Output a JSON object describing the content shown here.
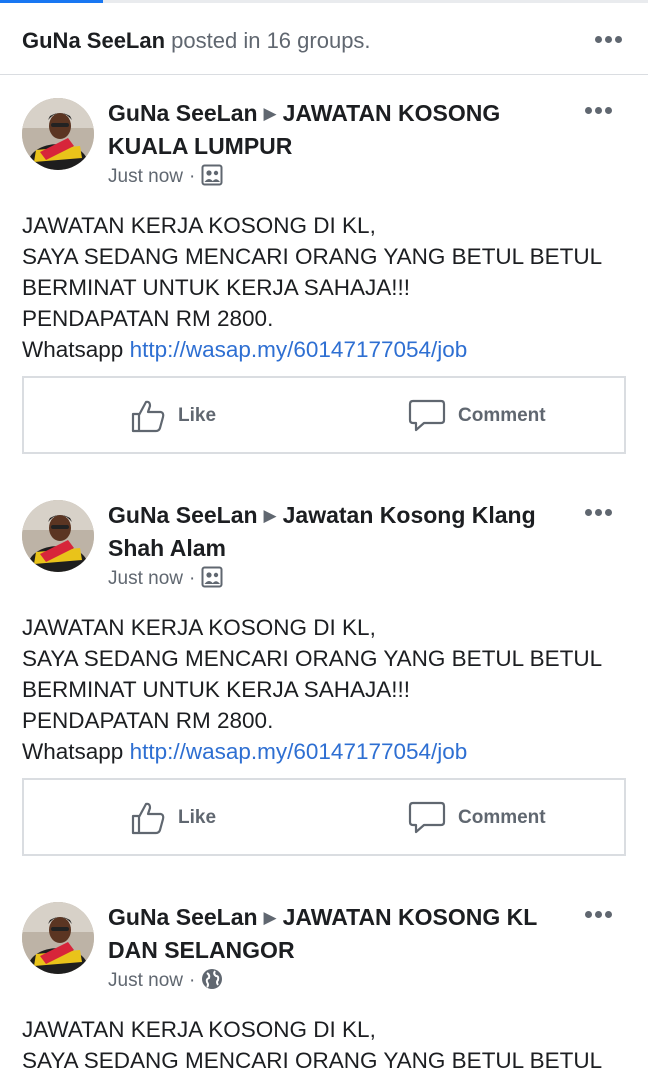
{
  "header": {
    "author": "GuNa SeeLan",
    "rest": "posted in 16 groups."
  },
  "posts": [
    {
      "author": "GuNa SeeLan",
      "group": "JAWATAN KOSONG KUALA LUMPUR",
      "time": "Just now",
      "audience_icon": "group-icon",
      "lines": [
        "JAWATAN KERJA KOSONG DI KL,",
        "SAYA SEDANG MENCARI ORANG YANG BETUL BETUL",
        "BERMINAT UNTUK KERJA SAHAJA!!!",
        "PENDAPATAN RM 2800."
      ],
      "link_prefix": "Whatsapp",
      "link": "http://wasap.my/60147177054/job",
      "like_label": "Like",
      "comment_label": "Comment"
    },
    {
      "author": "GuNa SeeLan",
      "group": "Jawatan Kosong Klang Shah Alam",
      "time": "Just now",
      "audience_icon": "group-icon",
      "lines": [
        "JAWATAN KERJA KOSONG DI KL,",
        "SAYA SEDANG MENCARI ORANG YANG BETUL BETUL",
        "BERMINAT UNTUK KERJA SAHAJA!!!",
        "PENDAPATAN RM 2800."
      ],
      "link_prefix": "Whatsapp",
      "link": "http://wasap.my/60147177054/job",
      "like_label": "Like",
      "comment_label": "Comment"
    },
    {
      "author": "GuNa SeeLan",
      "group": "JAWATAN KOSONG KL DAN SELANGOR",
      "time": "Just now",
      "audience_icon": "globe-icon",
      "lines": [
        "JAWATAN KERJA KOSONG DI KL,",
        "SAYA SEDANG MENCARI ORANG YANG BETUL BETUL"
      ]
    }
  ],
  "colors": {
    "link": "#2e6fd2",
    "secondary_text": "#606770",
    "accent_tab": "#1877f2"
  }
}
